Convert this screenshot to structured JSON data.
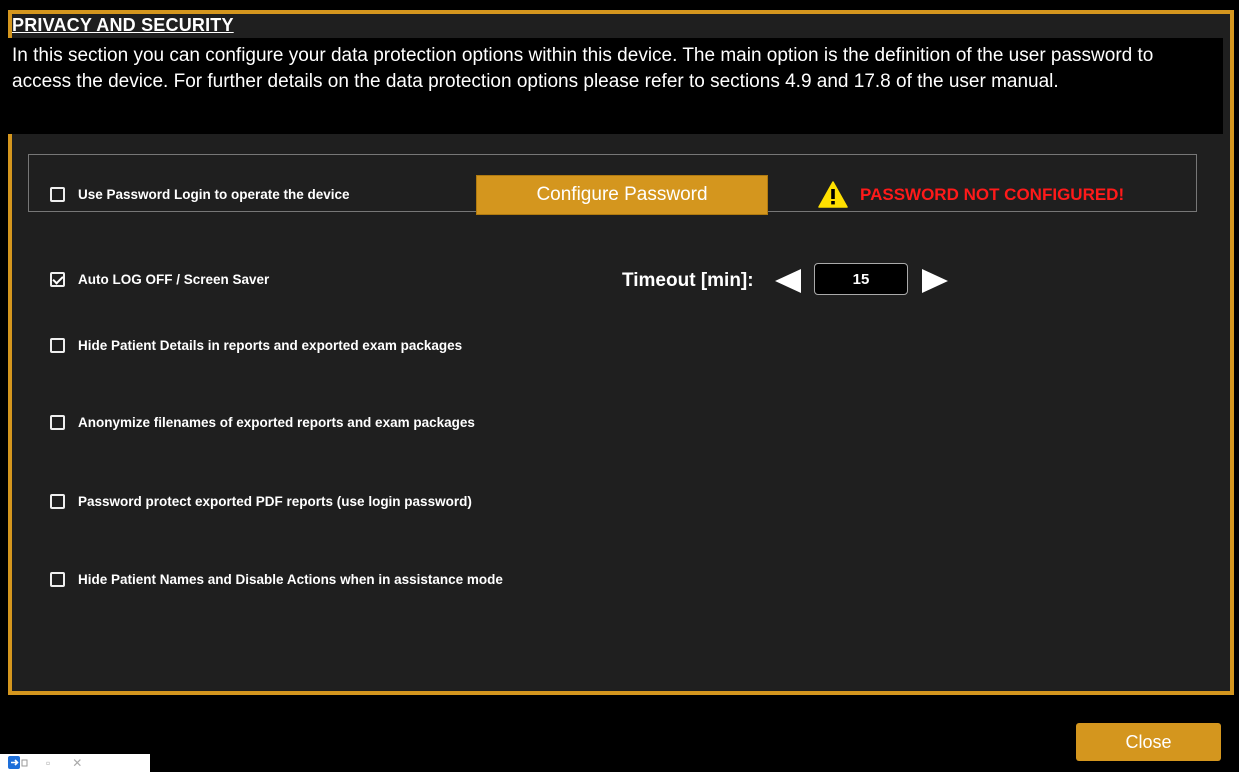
{
  "section": {
    "title": "PRIVACY AND SECURITY",
    "description": "In this section you can configure your data protection options within this device. The main option is the definition of the user password to access the device.  For further details on the data protection options please refer to sections 4.9 and 17.8 of the user manual."
  },
  "password": {
    "use_login_label": "Use Password Login to operate the device",
    "use_login_checked": false,
    "configure_button": "Configure Password",
    "warning": "PASSWORD NOT CONFIGURED!"
  },
  "autolog": {
    "label": "Auto LOG OFF / Screen Saver",
    "checked": true,
    "timeout_label": "Timeout [min]:",
    "timeout_value": "15"
  },
  "options": [
    {
      "label": "Hide Patient Details in reports and exported exam packages",
      "checked": false
    },
    {
      "label": "Anonymize filenames of exported reports and exam packages",
      "checked": false
    },
    {
      "label": "Password protect exported PDF reports (use login password)",
      "checked": false
    },
    {
      "label": "Hide Patient Names and Disable Actions when in assistance mode",
      "checked": false
    }
  ],
  "footer": {
    "close_button": "Close"
  },
  "colors": {
    "accent": "#d4961e",
    "warning": "#ff1a1a",
    "panel_bg": "#1f1f1f",
    "warning_icon": "#ffe000"
  },
  "icons": {
    "warning": "warning-triangle-icon",
    "decrement": "triangle-left-icon",
    "increment": "triangle-right-icon"
  }
}
